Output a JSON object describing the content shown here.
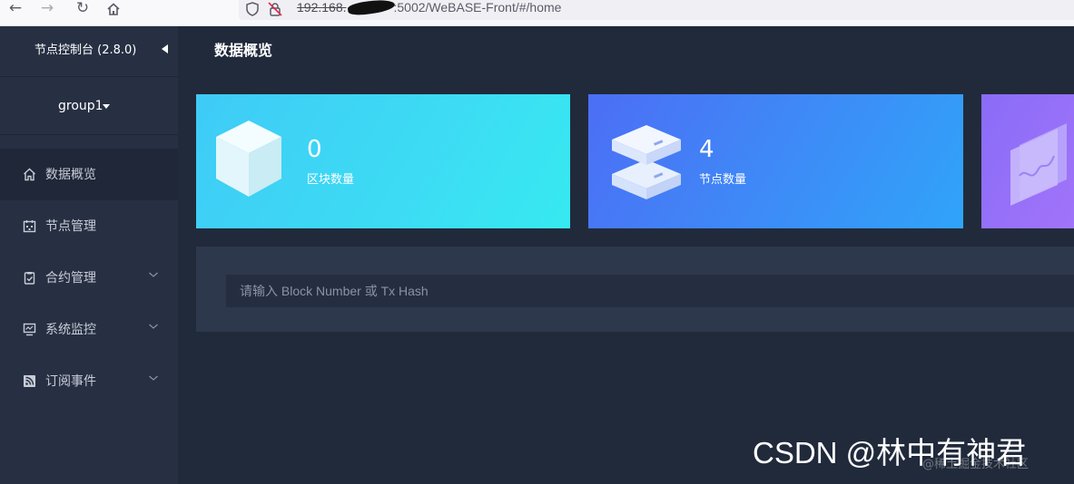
{
  "browser": {
    "url_host": "192.168.",
    "url_rest": ":5002/WeBASE-Front/#/home"
  },
  "sidebar": {
    "title": "节点控制台 (2.8.0)",
    "group": "group1",
    "items": [
      {
        "label": "数据概览",
        "icon": "home-icon",
        "active": true
      },
      {
        "label": "节点管理",
        "icon": "calendar-icon"
      },
      {
        "label": "合约管理",
        "icon": "clipboard-icon",
        "expandable": true
      },
      {
        "label": "系统监控",
        "icon": "monitor-icon",
        "expandable": true
      },
      {
        "label": "订阅事件",
        "icon": "rss-icon",
        "expandable": true
      }
    ]
  },
  "main": {
    "title": "数据概览",
    "cards": [
      {
        "value": "0",
        "label": "区块数量",
        "icon": "cube-icon"
      },
      {
        "value": "4",
        "label": "节点数量",
        "icon": "server-icon"
      },
      {
        "icon": "chart-panel-icon"
      }
    ],
    "search": {
      "placeholder": "请输入 Block Number 或 Tx Hash",
      "value": ""
    }
  },
  "watermark": {
    "main": "CSDN @林中有神君",
    "sub": "@稀土掘金技术社区"
  },
  "colors": {
    "sidebar_bg": "#273043",
    "main_bg": "#212a3b",
    "card_blocks": "#3ddcf4",
    "card_nodes": "#3d8cf7",
    "card_tx": "#9a72f9"
  }
}
